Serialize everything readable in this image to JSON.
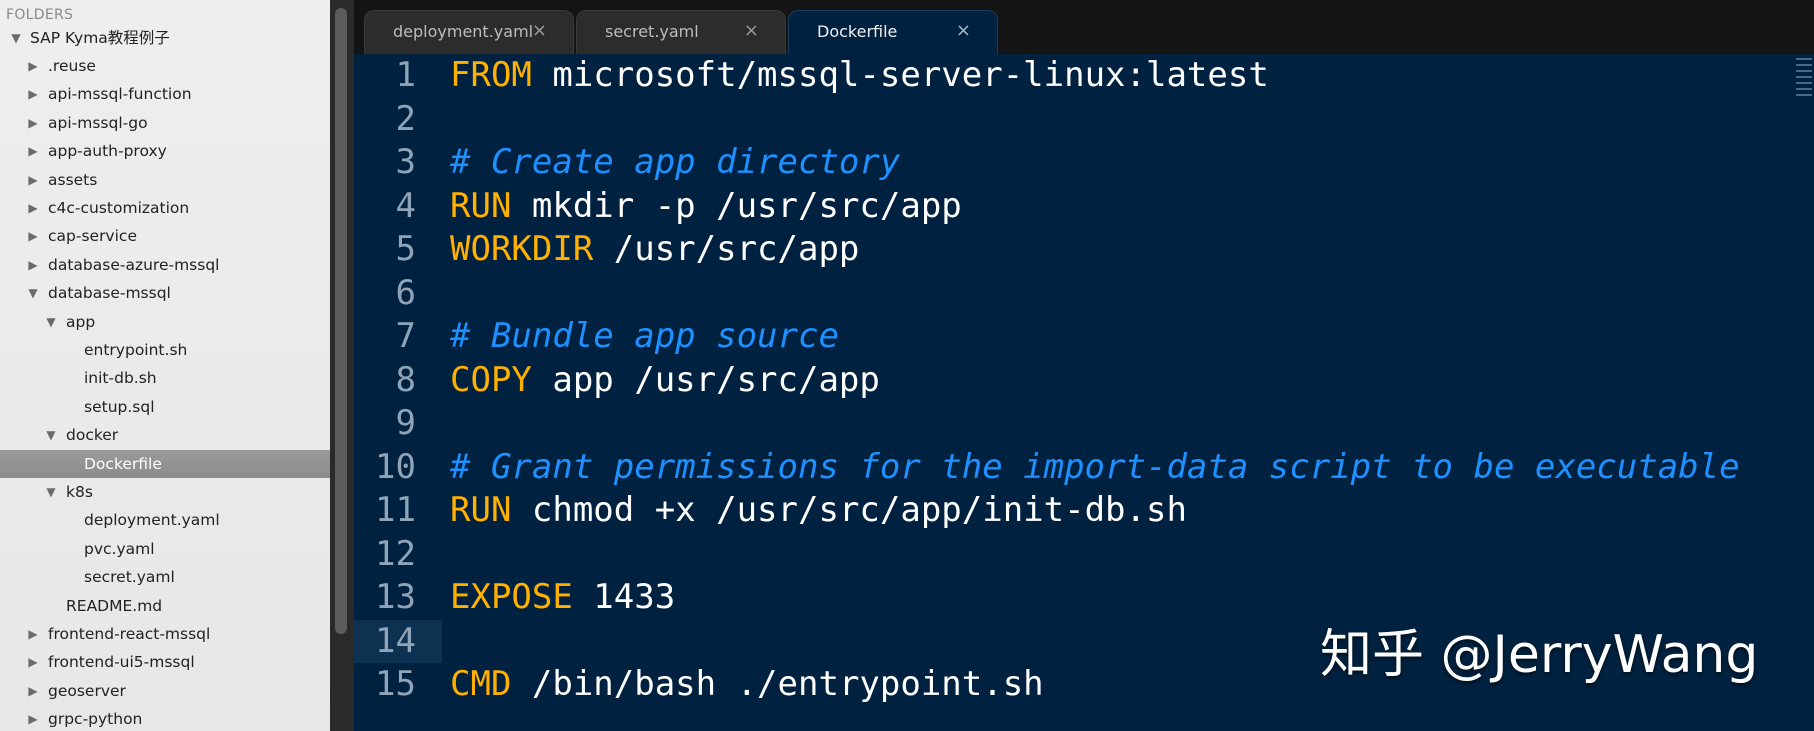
{
  "sidebar": {
    "header": "FOLDERS",
    "root": "SAP Kyma教程例子",
    "items": [
      {
        "label": ".reuse",
        "state": "collapsed",
        "depth": 1
      },
      {
        "label": "api-mssql-function",
        "state": "collapsed",
        "depth": 1
      },
      {
        "label": "api-mssql-go",
        "state": "collapsed",
        "depth": 1
      },
      {
        "label": "app-auth-proxy",
        "state": "collapsed",
        "depth": 1
      },
      {
        "label": "assets",
        "state": "collapsed",
        "depth": 1
      },
      {
        "label": "c4c-customization",
        "state": "collapsed",
        "depth": 1
      },
      {
        "label": "cap-service",
        "state": "collapsed",
        "depth": 1
      },
      {
        "label": "database-azure-mssql",
        "state": "collapsed",
        "depth": 1
      },
      {
        "label": "database-mssql",
        "state": "expanded",
        "depth": 1
      },
      {
        "label": "app",
        "state": "expanded",
        "depth": 2
      },
      {
        "label": "entrypoint.sh",
        "state": "file",
        "depth": 3
      },
      {
        "label": "init-db.sh",
        "state": "file",
        "depth": 3
      },
      {
        "label": "setup.sql",
        "state": "file",
        "depth": 3
      },
      {
        "label": "docker",
        "state": "expanded",
        "depth": 2
      },
      {
        "label": "Dockerfile",
        "state": "file-selected",
        "depth": 3
      },
      {
        "label": "k8s",
        "state": "expanded",
        "depth": 2
      },
      {
        "label": "deployment.yaml",
        "state": "file",
        "depth": 3
      },
      {
        "label": "pvc.yaml",
        "state": "file",
        "depth": 3
      },
      {
        "label": "secret.yaml",
        "state": "file",
        "depth": 3
      },
      {
        "label": "README.md",
        "state": "file",
        "depth": 2
      },
      {
        "label": "frontend-react-mssql",
        "state": "collapsed",
        "depth": 1
      },
      {
        "label": "frontend-ui5-mssql",
        "state": "collapsed",
        "depth": 1
      },
      {
        "label": "geoserver",
        "state": "collapsed",
        "depth": 1
      },
      {
        "label": "grpc-python",
        "state": "collapsed",
        "depth": 1
      }
    ]
  },
  "tabs": [
    {
      "label": "deployment.yaml",
      "close": "×",
      "active": false
    },
    {
      "label": "secret.yaml",
      "close": "×",
      "active": false
    },
    {
      "label": "Dockerfile",
      "close": "×",
      "active": true
    }
  ],
  "editor": {
    "current_line": 14,
    "lines": [
      {
        "n": "1",
        "kw": "FROM",
        "rest": " microsoft/mssql-server-linux:latest",
        "comment": ""
      },
      {
        "n": "2",
        "kw": "",
        "rest": "",
        "comment": ""
      },
      {
        "n": "3",
        "kw": "",
        "rest": "",
        "comment": "# Create app directory"
      },
      {
        "n": "4",
        "kw": "RUN",
        "rest": " mkdir -p /usr/src/app",
        "comment": ""
      },
      {
        "n": "5",
        "kw": "WORKDIR",
        "rest": " /usr/src/app",
        "comment": ""
      },
      {
        "n": "6",
        "kw": "",
        "rest": "",
        "comment": ""
      },
      {
        "n": "7",
        "kw": "",
        "rest": "",
        "comment": "# Bundle app source"
      },
      {
        "n": "8",
        "kw": "COPY",
        "rest": " app /usr/src/app",
        "comment": ""
      },
      {
        "n": "9",
        "kw": "",
        "rest": "",
        "comment": ""
      },
      {
        "n": "10",
        "kw": "",
        "rest": "",
        "comment": "# Grant permissions for the import-data script to be executable"
      },
      {
        "n": "11",
        "kw": "RUN",
        "rest": " chmod +x /usr/src/app/init-db.sh",
        "comment": ""
      },
      {
        "n": "12",
        "kw": "",
        "rest": "",
        "comment": ""
      },
      {
        "n": "13",
        "kw": "EXPOSE",
        "rest": " 1433",
        "comment": ""
      },
      {
        "n": "14",
        "kw": "",
        "rest": "",
        "comment": ""
      },
      {
        "n": "15",
        "kw": "CMD",
        "rest": " /bin/bash ./entrypoint.sh",
        "comment": ""
      }
    ]
  },
  "watermark": "知乎 @JerryWang",
  "colors": {
    "editor_bg": "#002240",
    "keyword": "#ffb000",
    "comment": "#1e90ff",
    "text": "#ffffff",
    "sidebar_bg": "#eeeeee",
    "selected_row": "#8c8c8c"
  }
}
